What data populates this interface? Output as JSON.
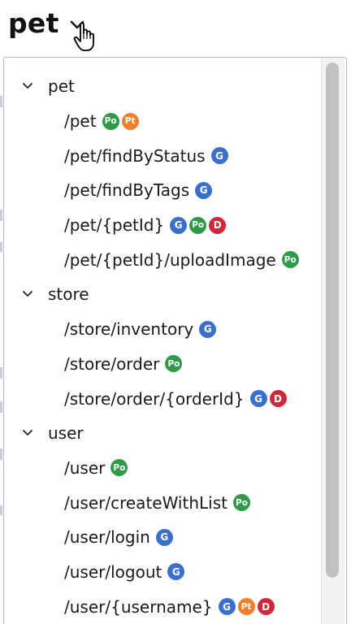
{
  "header": {
    "title": "pet"
  },
  "colors": {
    "get": "#3b6fcc",
    "post": "#2f9a4a",
    "put": "#f07e2c",
    "delete": "#d0283b"
  },
  "groups": [
    {
      "label": "pet",
      "paths": [
        {
          "path": "/pet",
          "methods": [
            "Po",
            "Pt"
          ]
        },
        {
          "path": "/pet/findByStatus",
          "methods": [
            "G"
          ]
        },
        {
          "path": "/pet/findByTags",
          "methods": [
            "G"
          ]
        },
        {
          "path": "/pet/{petId}",
          "methods": [
            "G",
            "Po",
            "D"
          ]
        },
        {
          "path": "/pet/{petId}/uploadImage",
          "methods": [
            "Po"
          ]
        }
      ]
    },
    {
      "label": "store",
      "paths": [
        {
          "path": "/store/inventory",
          "methods": [
            "G"
          ]
        },
        {
          "path": "/store/order",
          "methods": [
            "Po"
          ]
        },
        {
          "path": "/store/order/{orderId}",
          "methods": [
            "G",
            "D"
          ]
        }
      ]
    },
    {
      "label": "user",
      "paths": [
        {
          "path": "/user",
          "methods": [
            "Po"
          ]
        },
        {
          "path": "/user/createWithList",
          "methods": [
            "Po"
          ]
        },
        {
          "path": "/user/login",
          "methods": [
            "G"
          ]
        },
        {
          "path": "/user/logout",
          "methods": [
            "G"
          ]
        },
        {
          "path": "/user/{username}",
          "methods": [
            "G",
            "Pt",
            "D"
          ]
        }
      ]
    }
  ]
}
